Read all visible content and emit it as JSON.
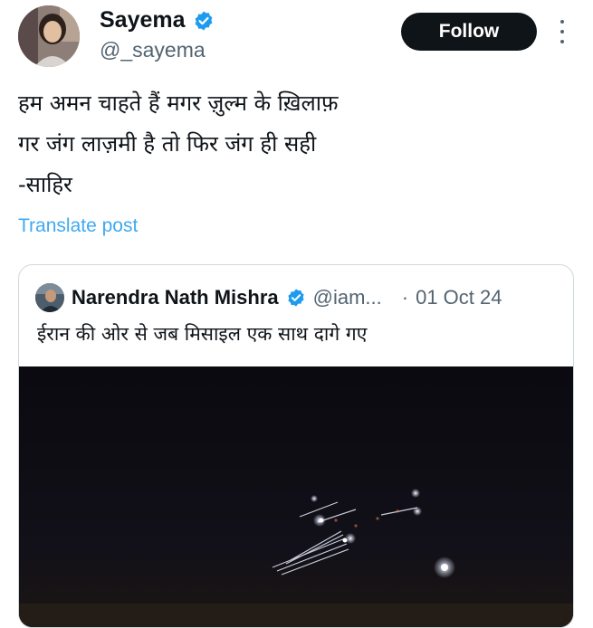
{
  "author": {
    "name": "Sayema",
    "handle": "@_sayema",
    "follow_label": "Follow",
    "verified_icon": "verified-badge-icon"
  },
  "post": {
    "lines": [
      "हम अमन चाहते हैं मगर ज़ुल्म के ख़िलाफ़",
      "गर जंग लाज़मी है तो फिर जंग ही सही",
      "-साहिर"
    ],
    "translate_label": "Translate post"
  },
  "quoted": {
    "name": "Narendra Nath Mishra",
    "handle": "@iam...",
    "separator": "·",
    "date": "01 Oct 24",
    "text": "ईरान की ओर से जब मिसाइल एक साथ दागे गए"
  },
  "colors": {
    "accent": "#1d9bf0",
    "text": "#0f1419",
    "muted": "#536471",
    "border": "#cfd9de",
    "button_bg": "#0f1419"
  }
}
